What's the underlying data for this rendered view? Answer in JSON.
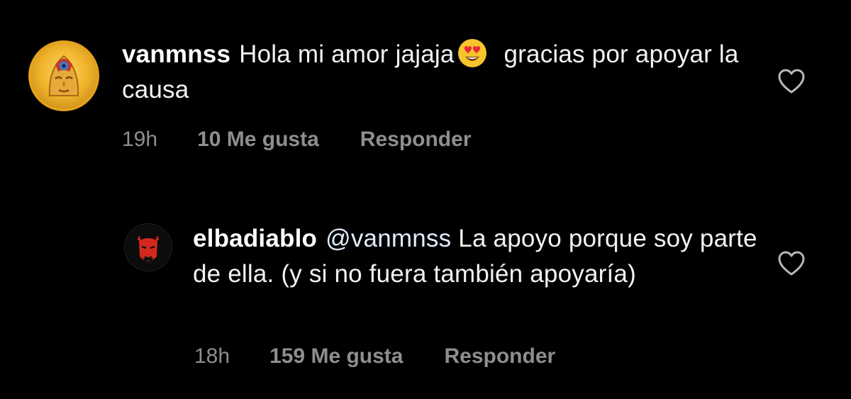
{
  "comments": [
    {
      "username": "vanmnss",
      "text_before_emoji": "Hola mi amor jajaja",
      "emoji": "heart-eyes-emoji",
      "text_after_emoji": "gracias por apoyar la causa",
      "time": "19h",
      "likes": "10 Me gusta",
      "reply": "Responder",
      "avatar": "golden-mask-avatar",
      "like_icon": "heart-outline-icon"
    },
    {
      "username": "elbadiablo",
      "mention": "@vanmnss",
      "text": "La apoyo porque soy parte de ella. (y si no fuera también apoyaría)",
      "time": "18h",
      "likes": "159 Me gusta",
      "reply": "Responder",
      "avatar": "red-devil-avatar",
      "like_icon": "heart-outline-icon"
    }
  ],
  "colors": {
    "background": "#000000",
    "primary_text": "#f2f2f2",
    "secondary_text": "#8e8e8e"
  }
}
